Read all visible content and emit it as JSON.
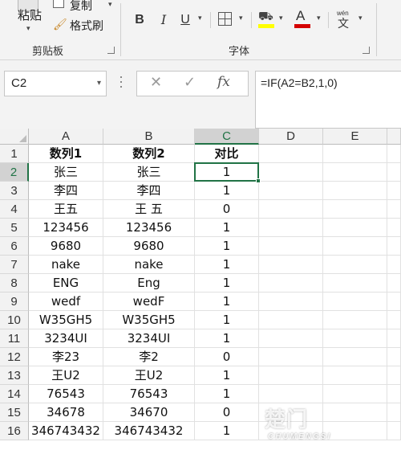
{
  "ribbon": {
    "clipboard": {
      "paste_label": "粘贴",
      "copy_label": "复制",
      "format_painter_label": "格式刷",
      "group_label": "剪贴板"
    },
    "font": {
      "bold_label": "B",
      "italic_label": "I",
      "underline_label": "U",
      "font_color_label": "A",
      "phonetic_top": "wén",
      "phonetic_bottom": "文",
      "fill_color": "#ffff00",
      "font_color": "#d40000",
      "group_label": "字体"
    }
  },
  "formula_bar": {
    "name_box": "C2",
    "cancel_icon": "✕",
    "enter_icon": "✓",
    "fx_label": "fx",
    "formula": "=IF(A2=B2,1,0)"
  },
  "grid": {
    "columns": [
      "A",
      "B",
      "C",
      "D",
      "E"
    ],
    "selected_column": "C",
    "selected_row": 2,
    "active_cell": "C2",
    "accent_color": "#217346",
    "rows": [
      {
        "n": "1",
        "a": "数列1",
        "b": "数列2",
        "c": "对比"
      },
      {
        "n": "2",
        "a": "张三",
        "b": "张三",
        "c": "1"
      },
      {
        "n": "3",
        "a": "李四",
        "b": "李四",
        "c": "1"
      },
      {
        "n": "4",
        "a": "王五",
        "b": "王 五",
        "c": "0"
      },
      {
        "n": "5",
        "a": "123456",
        "b": "123456",
        "c": "1"
      },
      {
        "n": "6",
        "a": "9680",
        "b": "9680",
        "c": "1"
      },
      {
        "n": "7",
        "a": "nake",
        "b": "nake",
        "c": "1"
      },
      {
        "n": "8",
        "a": "ENG",
        "b": "Eng",
        "c": "1"
      },
      {
        "n": "9",
        "a": "wedf",
        "b": "wedF",
        "c": "1"
      },
      {
        "n": "10",
        "a": "W35GH5",
        "b": "W35GH5",
        "c": "1"
      },
      {
        "n": "11",
        "a": "3234UI",
        "b": "3234UI",
        "c": "1"
      },
      {
        "n": "12",
        "a": "李23",
        "b": "李2",
        "c": "0"
      },
      {
        "n": "13",
        "a": "王U2",
        "b": "王U2",
        "c": "1"
      },
      {
        "n": "14",
        "a": "76543",
        "b": "76543",
        "c": "1"
      },
      {
        "n": "15",
        "a": "34678",
        "b": "34670",
        "c": "0"
      },
      {
        "n": "16",
        "a": "346743432",
        "b": "346743432",
        "c": "1"
      }
    ]
  },
  "watermark": {
    "logo_text": "楚门",
    "brand_text": "CHUMENGSI"
  }
}
